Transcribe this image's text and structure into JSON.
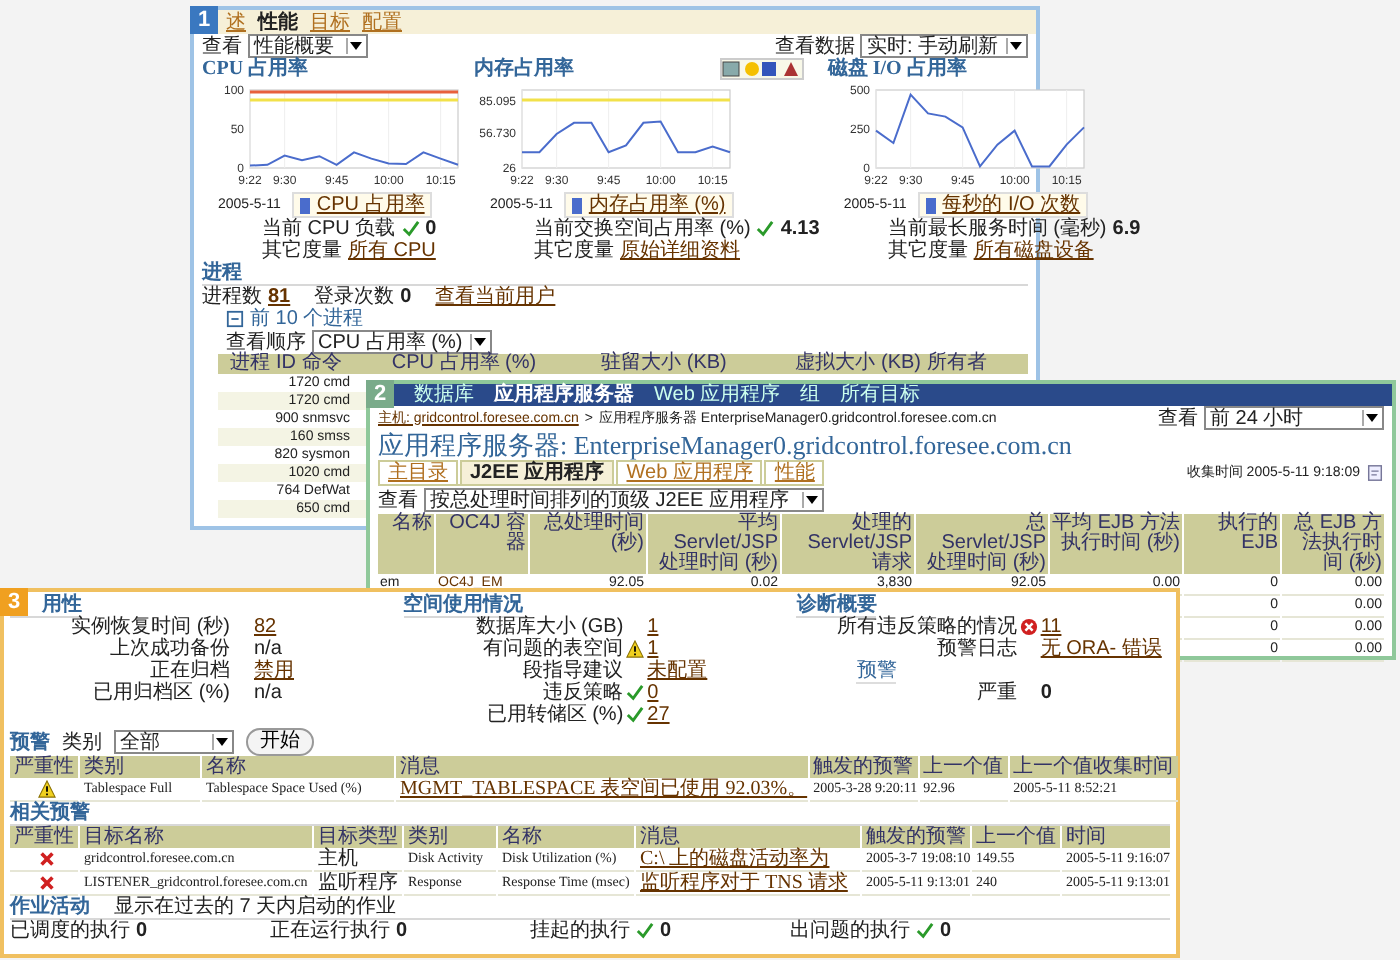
{
  "window_1": {
    "badge": "1",
    "tabs": [
      {
        "label": "述",
        "selected": false
      },
      {
        "label": "性能",
        "selected": true
      },
      {
        "label": "目标",
        "selected": false
      },
      {
        "label": "配置",
        "selected": false
      }
    ],
    "view": {
      "label": "查看",
      "value": "性能概要"
    },
    "data_view": {
      "label": "查看数据",
      "value": "实时: 手动刷新"
    },
    "charts": [
      {
        "title": "CPU 占用率",
        "date": "2005-5-11",
        "toolbar": false,
        "metric": {
          "label": "当前 CPU 负载",
          "ok": true,
          "value": "0"
        },
        "other": {
          "label": "其它度量",
          "link": "所有 CPU"
        },
        "chart_data": {
          "type": "line",
          "categories": [
            "9:22",
            null,
            "9:30",
            null,
            null,
            "9:45",
            null,
            null,
            "10:00",
            null,
            null,
            "10:15",
            null
          ],
          "series": [
            {
              "name": "CPU 占用率",
              "color": "#4a6ccc",
              "values": [
                3,
                4,
                16,
                10,
                15,
                4,
                20,
                12,
                6,
                5,
                20,
                12,
                4
              ]
            }
          ],
          "ylim": [
            0,
            100
          ],
          "yticks": [
            0,
            50,
            100
          ],
          "grid": true
        },
        "thresholds": [
          {
            "kind": "critical"
          },
          {
            "kind": "warning"
          }
        ]
      },
      {
        "title": "内存占用率",
        "date": "2005-5-11",
        "toolbar": true,
        "metric": {
          "label": "当前交换空间占用率 (%)",
          "ok": true,
          "value": "4.13"
        },
        "other": {
          "label": "其它度量",
          "link": "原始详细资料"
        },
        "chart_data": {
          "type": "line",
          "categories": [
            "9:22",
            null,
            "9:30",
            null,
            null,
            "9:45",
            null,
            null,
            "10:00",
            null,
            null,
            "10:15",
            null
          ],
          "series": [
            {
              "name": "内存占用率 (%)",
              "color": "#4a6ccc",
              "values": [
                40,
                40,
                56,
                66,
                66,
                40,
                46,
                66,
                67,
                40,
                40,
                45,
                40
              ]
            }
          ],
          "ylim": [
            26,
            95
          ],
          "yticks": [
            {
              "value": 26,
              "label": "26"
            },
            {
              "value": 56.73,
              "label": "56.730"
            },
            {
              "value": 85.095,
              "label": "85.095"
            }
          ],
          "grid": true
        },
        "thresholds": [
          {
            "kind": "warning"
          }
        ]
      },
      {
        "title": "磁盘 I/O 占用率",
        "date": "2005-5-11",
        "toolbar": false,
        "metric": {
          "label": "当前最长服务时间 (毫秒)",
          "ok": false,
          "value": "6.9"
        },
        "other": {
          "label": "其它度量",
          "link": "所有磁盘设备"
        },
        "chart_data": {
          "type": "line",
          "categories": [
            "9:22",
            null,
            "9:30",
            null,
            null,
            "9:45",
            null,
            null,
            "10:00",
            null,
            null,
            "10:15",
            null
          ],
          "series": [
            {
              "name": "每秒的 I/O 次数",
              "color": "#4a6ccc",
              "values": [
                240,
                160,
                470,
                350,
                330,
                260,
                10,
                150,
                240,
                10,
                10,
                150,
                260
              ]
            }
          ],
          "ylim": [
            0,
            500
          ],
          "yticks": [
            0,
            250,
            500
          ],
          "grid": true
        }
      }
    ],
    "processes": {
      "title": "进程",
      "count_label": "进程数",
      "count": "81",
      "logins_label": "登录次数",
      "logins": "0",
      "link": "查看当前用户",
      "top_title": "前 10 个进程",
      "expanded": true,
      "sort_label": "查看顺序",
      "sort_value": "CPU 占用率 (%)",
      "columns": [
        "进程 ID 命令",
        "CPU 占用率 (%)",
        "驻留大小 (KB)",
        "虚拟大小 (KB) 所有者"
      ],
      "rows": [
        "1720 cmd",
        "1720 cmd",
        "900 snmsvc",
        "160 smss",
        "820 sysmon",
        "1020 cmd",
        "764 DefWat",
        "650 cmd"
      ]
    }
  },
  "window_2": {
    "badge": "2",
    "tabs": [
      {
        "label": "数据库",
        "selected": false
      },
      {
        "label": "应用程序服务器",
        "selected": true
      },
      {
        "label": "Web 应用程序",
        "selected": false
      },
      {
        "label": "组",
        "selected": false
      },
      {
        "label": "所有目标",
        "selected": false
      }
    ],
    "breadcrumb": {
      "link": "主机: gridcontrol.foresee.com.cn",
      "separator": ">",
      "current": "应用程序服务器 EnterpriseManager0.gridcontrol.foresee.com.cn"
    },
    "view": {
      "label": "查看",
      "value": "前 24 小时"
    },
    "title": "应用程序服务器: EnterpriseManager0.gridcontrol.foresee.com.cn",
    "subtabs": [
      {
        "label": "主目录",
        "selected": false
      },
      {
        "label": "J2EE 应用程序",
        "selected": true
      },
      {
        "label": "Web 应用程序",
        "selected": false
      },
      {
        "label": "性能",
        "selected": false
      }
    ],
    "collected": "收集时间 2005-5-11 9:18:09",
    "table_view": {
      "label": "查看",
      "value": "按总处理时间排列的顶级 J2EE 应用程序"
    },
    "columns": [
      "名称",
      "OC4J 容器",
      "总处理时间 (秒)",
      "平均Servlet/JSP 处理时间 (秒)",
      "处理的 Servlet/JSP 请求",
      "总 Servlet/JSP 处理时间 (秒)",
      "平均 EJB 方法执行时间 (秒)",
      "执行的 EJB",
      "总 EJB 方法执行时间 (秒)"
    ],
    "rows": [
      [
        "em",
        "OC4J_EM",
        "92.05",
        "0.02",
        "3,830",
        "92.05",
        "0.00",
        "0",
        "0.00"
      ]
    ],
    "tail_rows": [
      [
        "0",
        "0.00"
      ],
      [
        "0",
        "0.00"
      ],
      [
        "0",
        "0.00"
      ]
    ]
  },
  "window_3": {
    "badge": "3",
    "availability": {
      "title": "用性",
      "items": [
        {
          "label": "实例恢复时间 (秒)",
          "value": "82",
          "link": true
        },
        {
          "label": "上次成功备份",
          "value": "n/a",
          "link": false
        },
        {
          "label": "正在归档",
          "value": "禁用",
          "link": true
        },
        {
          "label": "已用归档区 (%)",
          "value": "n/a",
          "link": false
        }
      ]
    },
    "space": {
      "title": "空间使用情况",
      "items": [
        {
          "label": "数据库大小 (GB)",
          "value": "1",
          "link": true
        },
        {
          "label": "有问题的表空间",
          "kind": "warning",
          "value": "1",
          "link": true
        },
        {
          "label": "段指导建议",
          "value": "未配置",
          "link": true
        },
        {
          "label": "违反策略",
          "kind": "ok",
          "value": "0",
          "link": true
        },
        {
          "label": "已用转储区 (%)",
          "kind": "ok",
          "value": "27",
          "link": true
        }
      ]
    },
    "diagnostics": {
      "title": "诊断概要",
      "items": [
        {
          "label": "所有违反策略的情况",
          "kind": "critical",
          "value": "11",
          "link": true
        },
        {
          "label": "预警日志",
          "value": "无 ORA- 错误",
          "link": true
        }
      ],
      "alerts_title": "预警",
      "severity_label": "严重",
      "severity_value": "0"
    },
    "alerts": {
      "title": "预警",
      "category_label": "类别",
      "category_value": "全部",
      "button": "开始",
      "columns": [
        "严重性",
        "类别",
        "名称",
        "消息",
        "触发的预警",
        "上一个值",
        "上一个值收集时间"
      ],
      "rows": [
        {
          "kind": "warning",
          "category": "Tablespace Full",
          "name": "Tablespace Space Used (%)",
          "message": "MGMT_TABLESPACE 表空间已使用 92.03%。",
          "triggered": "2005-3-28 9:20:11",
          "last_value": "92.96",
          "time": "2005-5-11 8:52:21"
        }
      ]
    },
    "related": {
      "title": "相关预警",
      "columns": [
        "严重性",
        "目标名称",
        "目标类型",
        "类别",
        "名称",
        "消息",
        "触发的预警",
        "上一个值",
        "时间"
      ],
      "rows": [
        {
          "kind": "critical",
          "target": "gridcontrol.foresee.com.cn",
          "target_type": "主机",
          "category": "Disk Activity",
          "name": "Disk Utilization (%)",
          "message": "C:\\ 上的磁盘活动率为",
          "triggered": "2005-3-7 19:08:10",
          "last_value": "149.55",
          "time": "2005-5-11 9:16:07"
        },
        {
          "kind": "critical",
          "target": "LISTENER_gridcontrol.foresee.com.cn",
          "target_type": "监听程序",
          "category": "Response",
          "name": "Response Time (msec)",
          "message": "监听程序对于 TNS 请求",
          "triggered": "2005-5-11 9:13:01",
          "last_value": "240",
          "time": "2005-5-11 9:13:01"
        }
      ]
    },
    "jobs": {
      "title": "作业活动",
      "description": "显示在过去的 7 天内启动的作业",
      "items": [
        {
          "label": "已调度的执行",
          "ok": false,
          "value": "0"
        },
        {
          "label": "正在运行执行",
          "ok": false,
          "value": "0"
        },
        {
          "label": "挂起的执行",
          "ok": true,
          "value": "0"
        },
        {
          "label": "出问题的执行",
          "ok": true,
          "value": "0"
        }
      ]
    }
  }
}
